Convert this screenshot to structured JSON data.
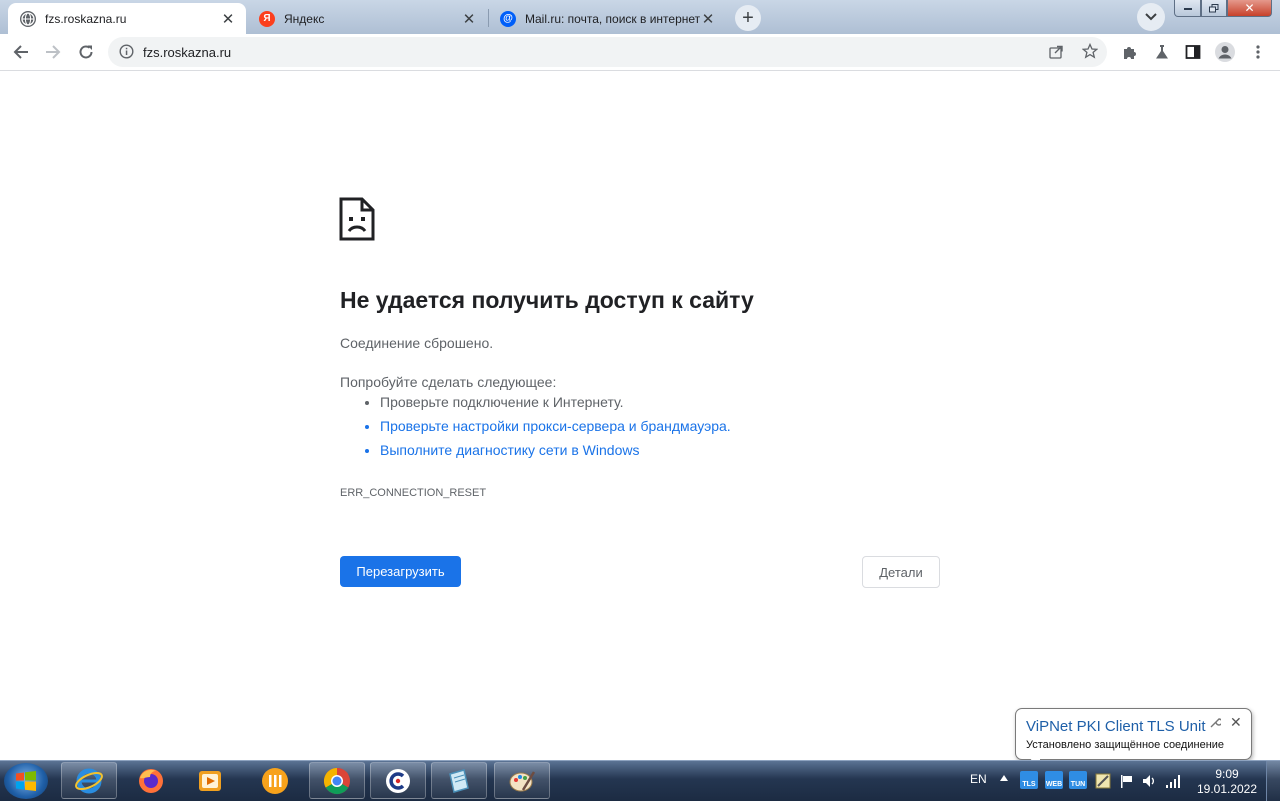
{
  "browser": {
    "tabs": [
      {
        "title": "fzs.roskazna.ru",
        "active": true,
        "favicon": "globe-icon"
      },
      {
        "title": "Яндекс",
        "active": false,
        "favicon": "yandex-logo-icon"
      },
      {
        "title": "Mail.ru: почта, поиск в интернете",
        "active": false,
        "favicon": "mailru-logo-icon"
      }
    ],
    "new_tab_symbol": "+",
    "close_symbol": "✕"
  },
  "toolbar": {
    "url": "fzs.roskazna.ru"
  },
  "error_page": {
    "title": "Не удается получить доступ к сайту",
    "subtitle": "Соединение сброшено.",
    "suggestions_intro": "Попробуйте сделать следующее:",
    "suggestions": [
      "Проверьте подключение к Интернету.",
      "Проверьте настройки прокси-сервера и брандмауэра.",
      "Выполните диагностику сети в Windows"
    ],
    "error_code": "ERR_CONNECTION_RESET",
    "reload_label": "Перезагрузить",
    "details_label": "Детали"
  },
  "notification": {
    "title": "ViPNet PKI Client TLS Unit",
    "text": "Установлено защищённое соединение"
  },
  "taskbar": {
    "apps": [
      "internet-explorer-icon",
      "firefox-icon",
      "media-player-icon",
      "odnoklassniki-icon",
      "chrome-icon",
      "c-app-icon",
      "notepad-app-icon",
      "paint-app-icon"
    ],
    "tray": {
      "language": "EN",
      "tls_label": "TLS",
      "web_label": "WEB",
      "tun_label": "TUN",
      "time": "9:09",
      "date": "19.01.2022"
    }
  },
  "colors": {
    "accent": "#1a73e8",
    "link": "#1a73e8",
    "taskbar": "#243651"
  }
}
